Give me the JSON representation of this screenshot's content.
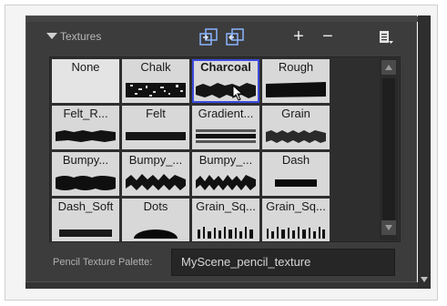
{
  "section": {
    "title": "Textures"
  },
  "toolbar": {
    "icons": [
      "import-texture-icon",
      "export-texture-icon"
    ],
    "add_label": "+",
    "remove_label": "−"
  },
  "textures": [
    {
      "label": "None",
      "selected": false
    },
    {
      "label": "Chalk",
      "selected": false
    },
    {
      "label": "Charcoal",
      "selected": true
    },
    {
      "label": "Rough",
      "selected": false
    },
    {
      "label": "Felt_R...",
      "selected": false
    },
    {
      "label": "Felt",
      "selected": false
    },
    {
      "label": "Gradient...",
      "selected": false
    },
    {
      "label": "Grain",
      "selected": false
    },
    {
      "label": "Bumpy...",
      "selected": false
    },
    {
      "label": "Bumpy_...",
      "selected": false
    },
    {
      "label": "Bumpy_...",
      "selected": false
    },
    {
      "label": "Dash",
      "selected": false
    },
    {
      "label": "Dash_Soft",
      "selected": false
    },
    {
      "label": "Dots",
      "selected": false
    },
    {
      "label": "Grain_Sq...",
      "selected": false
    },
    {
      "label": "Grain_Sq...",
      "selected": false
    }
  ],
  "palette": {
    "label": "Pencil Texture Palette:",
    "value": "MyScene_pencil_texture"
  },
  "colors": {
    "panel_bg": "#3c3c3c",
    "tile_bg": "#d8d8d8",
    "selection": "#3b4bdc"
  }
}
